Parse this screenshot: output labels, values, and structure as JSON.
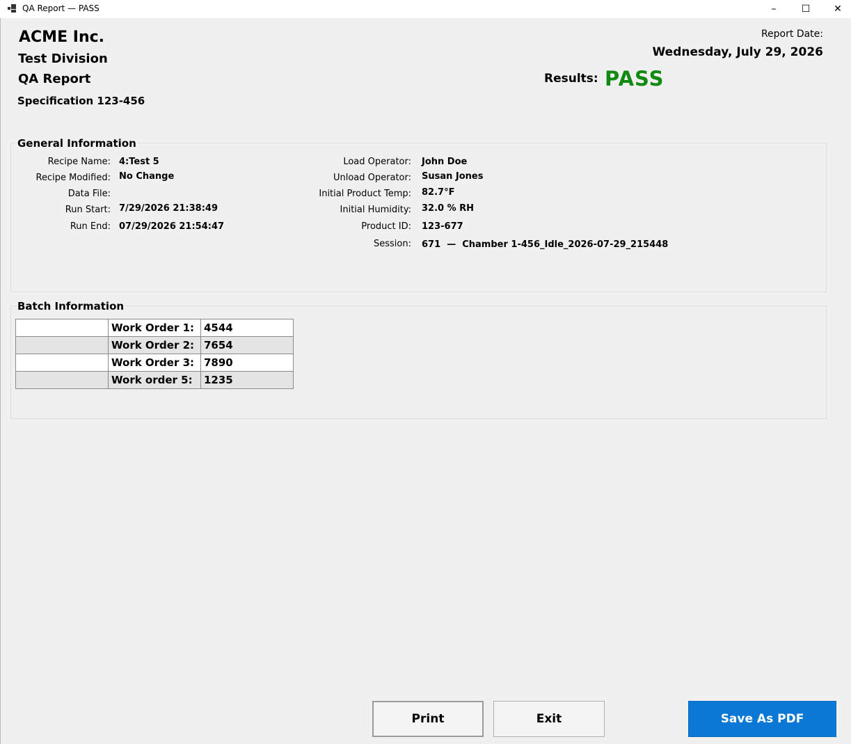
{
  "window": {
    "title": "QA Report — PASS",
    "minimize_glyph": "–",
    "maximize_glyph": "☐",
    "close_glyph": "✕"
  },
  "header": {
    "company": "ACME Inc.",
    "division": "Test Division",
    "report_title": "QA Report",
    "specification": "Specification 123-456",
    "report_date_label": "Report Date:",
    "report_date": "Wednesday, July 29, 2026",
    "results_label": "Results:",
    "results_value": "PASS"
  },
  "colors": {
    "pass": "#118a11",
    "primary_button": "#0a78d4"
  },
  "general_info": {
    "title": "General Information",
    "left": [
      {
        "label": "Recipe Name:",
        "value": "4:Test 5"
      },
      {
        "label": "Recipe Modified:",
        "value": "No Change"
      },
      {
        "label": "Data File:",
        "value": ""
      },
      {
        "label": "Run Start:",
        "value": "7/29/2026 21:38:49"
      },
      {
        "label": "Run End:",
        "value": "07/29/2026 21:54:47"
      }
    ],
    "right": [
      {
        "label": "Load Operator:",
        "value": "John Doe"
      },
      {
        "label": "Unload Operator:",
        "value": "Susan Jones"
      },
      {
        "label": "Initial Product Temp:",
        "value": "82.7°F"
      },
      {
        "label": "Initial Humidity:",
        "value": "32.0 % RH"
      },
      {
        "label": "Product ID:",
        "value": "123-677"
      },
      {
        "label": "Session:",
        "value": "671  —  Chamber 1-456_Idle_2026-07-29_215448"
      }
    ]
  },
  "batch_info": {
    "title": "Batch Information",
    "rows": [
      {
        "blank": "",
        "label": "Work Order 1:",
        "value": "4544"
      },
      {
        "blank": "",
        "label": "Work Order 2:",
        "value": "7654"
      },
      {
        "blank": "",
        "label": "Work Order 3:",
        "value": "7890"
      },
      {
        "blank": "",
        "label": "Work order 5:",
        "value": "1235"
      }
    ]
  },
  "buttons": {
    "print": "Print",
    "exit": "Exit",
    "save_pdf": "Save As PDF"
  }
}
